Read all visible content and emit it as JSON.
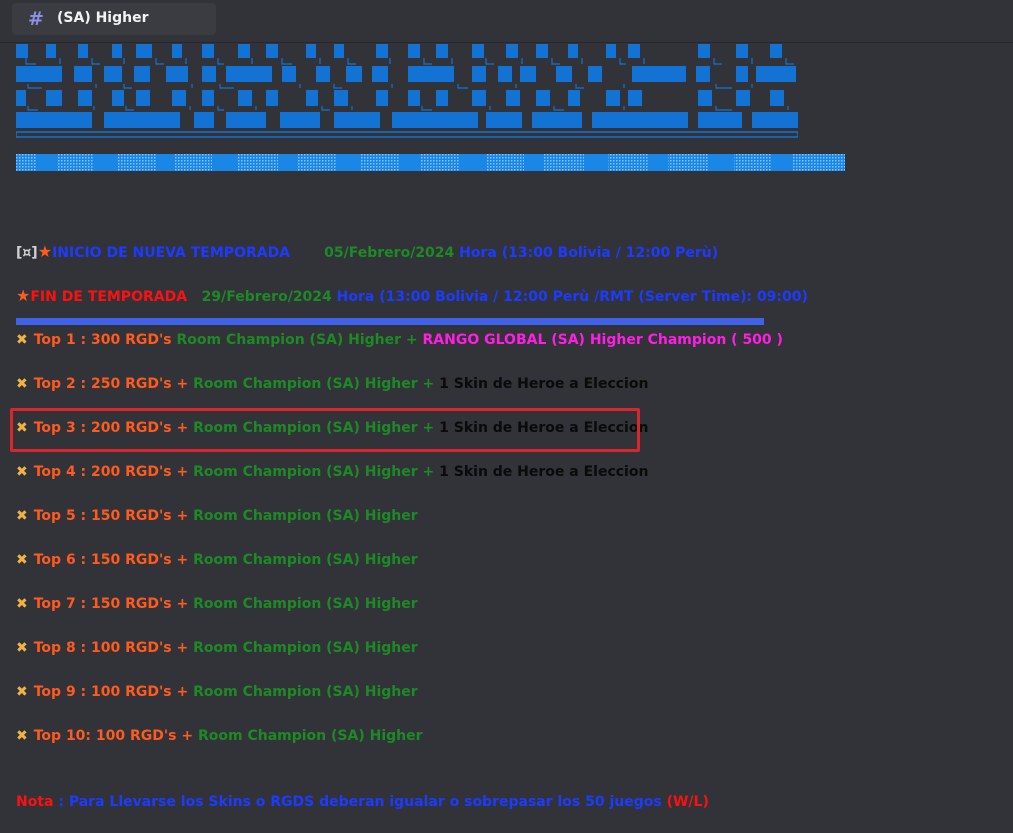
{
  "header": {
    "channel_title": "(SA) Higher",
    "hash_icon": "hash-icon"
  },
  "colors": {
    "orange": "#ff5a1f",
    "green": "#1d8a25",
    "blue": "#1d3bff",
    "red": "#ff1010",
    "magenta": "#ff1ee3",
    "highlight": "#d9262c",
    "bar": "#3f62e8"
  },
  "season": {
    "start_prefix": "[¤]",
    "start_label": "INICIO DE NUEVA TEMPORADA",
    "start_date": "05/Febrero/2024",
    "start_time": "Hora (13:00  Bolivia / 12:00 Perù)",
    "end_label": "FIN DE TEMPORADA",
    "end_date": "29/Febrero/2024",
    "end_time": "Hora (13:00  Bolivia / 12:00 Perù /RMT (Server Time): 09:00)"
  },
  "ranking": [
    {
      "rank": "Top 1 : 300 RGD's ",
      "room": "Room Champion (SA) Higher",
      "plus": " + ",
      "extra": "RANGO GLOBAL (SA) Higher Champion ( 500 )",
      "extra_type": "magenta"
    },
    {
      "rank": "Top 2 : 250 RGD's + ",
      "room": "Room Champion (SA) Higher",
      "plus": " + ",
      "extra": "1 Skin de Heroe a Eleccion",
      "extra_type": "black"
    },
    {
      "rank": "Top 3 : 200 RGD's + ",
      "room": "Room Champion (SA) Higher",
      "plus": " + ",
      "extra": "1 Skin de Heroe a Eleccion",
      "extra_type": "black"
    },
    {
      "rank": "Top 4 : 200 RGD's + ",
      "room": "Room Champion (SA) Higher",
      "plus": " + ",
      "extra": "1 Skin de Heroe a Eleccion",
      "extra_type": "black"
    },
    {
      "rank": "Top 5 : 150 RGD's + ",
      "room": "Room Champion (SA) Higher",
      "plus": "",
      "extra": "",
      "extra_type": ""
    },
    {
      "rank": "Top 6 : 150 RGD's + ",
      "room": "Room Champion (SA) Higher",
      "plus": "",
      "extra": "",
      "extra_type": ""
    },
    {
      "rank": "Top 7 : 150 RGD's + ",
      "room": "Room Champion (SA) Higher",
      "plus": "",
      "extra": "",
      "extra_type": ""
    },
    {
      "rank": "Top 8 :  100 RGD's  + ",
      "room": "Room Champion (SA) Higher",
      "plus": "",
      "extra": "",
      "extra_type": ""
    },
    {
      "rank": "Top 9 :  100 RGD's  + ",
      "room": "Room Champion (SA) Higher",
      "plus": "",
      "extra": "",
      "extra_type": ""
    },
    {
      "rank": "Top 10: 100 RGD's  + ",
      "room": "Room Champion (SA) Higher",
      "plus": "",
      "extra": "",
      "extra_type": ""
    }
  ],
  "note": {
    "label": "Nota",
    "separator": " : ",
    "text": "Para Llevarse los Skins o RGDS deberan igualar o sobrepasar los 50 juegos",
    "suffix": " (W/L)"
  }
}
